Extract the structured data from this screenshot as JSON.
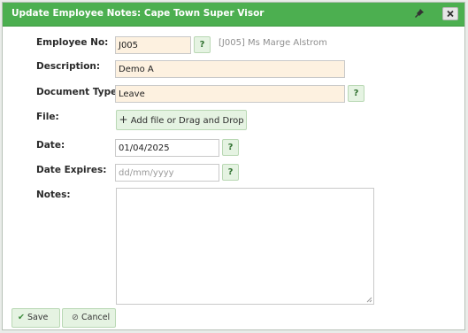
{
  "dialog": {
    "title": "Update Employee Notes: Cape Town Super Visor",
    "close_label": "×"
  },
  "form": {
    "employee_no": {
      "label": "Employee No:",
      "value": "J005",
      "help": "?",
      "description": "[J005] Ms Marge Alstrom"
    },
    "description": {
      "label": "Description:",
      "value": "Demo A"
    },
    "document_type": {
      "label": "Document Type:",
      "value": "Leave",
      "help": "?"
    },
    "file": {
      "label": "File:",
      "button_label": "Add file or Drag and Drop",
      "button_icon": "+"
    },
    "date": {
      "label": "Date:",
      "value": "01/04/2025",
      "help": "?"
    },
    "date_expires": {
      "label": "Date Expires:",
      "placeholder": "dd/mm/yyyy",
      "help": "?"
    },
    "notes": {
      "label": "Notes:",
      "value": ""
    }
  },
  "actions": {
    "save": {
      "icon": "✔",
      "label": "Save"
    },
    "cancel": {
      "icon": "⊘",
      "label": "Cancel"
    }
  },
  "colors": {
    "title_bar": "#4caf50",
    "required_field": "#fdf1e0",
    "button_bg": "#e5f3e2",
    "button_border": "#b9d8b4"
  }
}
